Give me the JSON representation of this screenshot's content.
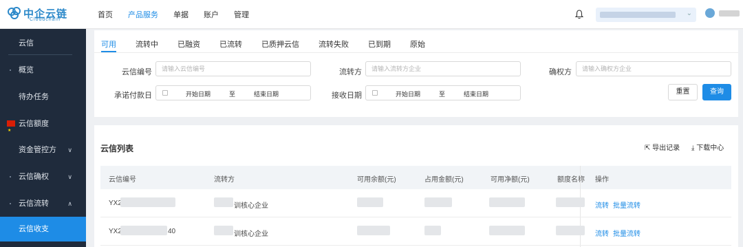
{
  "brand": {
    "name": "中企云链",
    "subtitle": "Cloudchain"
  },
  "topnav": [
    {
      "label": "首页",
      "active": false
    },
    {
      "label": "产品服务",
      "active": true
    },
    {
      "label": "单据",
      "active": false
    },
    {
      "label": "账户",
      "active": false
    },
    {
      "label": "管理",
      "active": false
    }
  ],
  "sidebar": {
    "items": [
      {
        "label": "云信"
      },
      {
        "label": "概览"
      },
      {
        "label": "待办任务"
      },
      {
        "label": "云信额度"
      },
      {
        "label": "资金管控方"
      },
      {
        "label": "云信确权"
      },
      {
        "label": "云信流转"
      },
      {
        "label": "云信收支",
        "active": true
      }
    ]
  },
  "filter": {
    "tabs": [
      "可用",
      "流转中",
      "已融资",
      "已流转",
      "已质押云信",
      "流转失败",
      "已到期",
      "原始"
    ],
    "active_tab": "可用",
    "fields": {
      "code_label": "云信编号",
      "code_placeholder": "请输入云信编号",
      "transfer_label": "流转方",
      "transfer_placeholder": "请输入流转方企业",
      "confirm_label": "确权方",
      "confirm_placeholder": "请输入确权方企业",
      "pay_date_label": "承诺付款日",
      "recv_date_label": "接收日期",
      "start_date": "开始日期",
      "to": "至",
      "end_date": "结束日期"
    },
    "buttons": {
      "reset": "重置",
      "query": "查询"
    }
  },
  "list": {
    "title": "云信列表",
    "export_label": "导出记录",
    "download_label": "下载中心",
    "columns": [
      "云信编号",
      "流转方",
      "可用余额(元)",
      "占用金额(元)",
      "可用净额(元)",
      "额度名称",
      "操作"
    ],
    "rows": [
      {
        "code_prefix": "YX2",
        "code_suffix": "",
        "transfer_suffix": "训核心企业",
        "op1": "流转",
        "op2": "批量流转"
      },
      {
        "code_prefix": "YX2",
        "code_suffix": "40",
        "transfer_suffix": "训核心企业",
        "op1": "流转",
        "op2": "批量流转"
      }
    ]
  },
  "colors": {
    "accent": "#1e8ce6",
    "sidebar_bg": "#1f2b3c"
  }
}
